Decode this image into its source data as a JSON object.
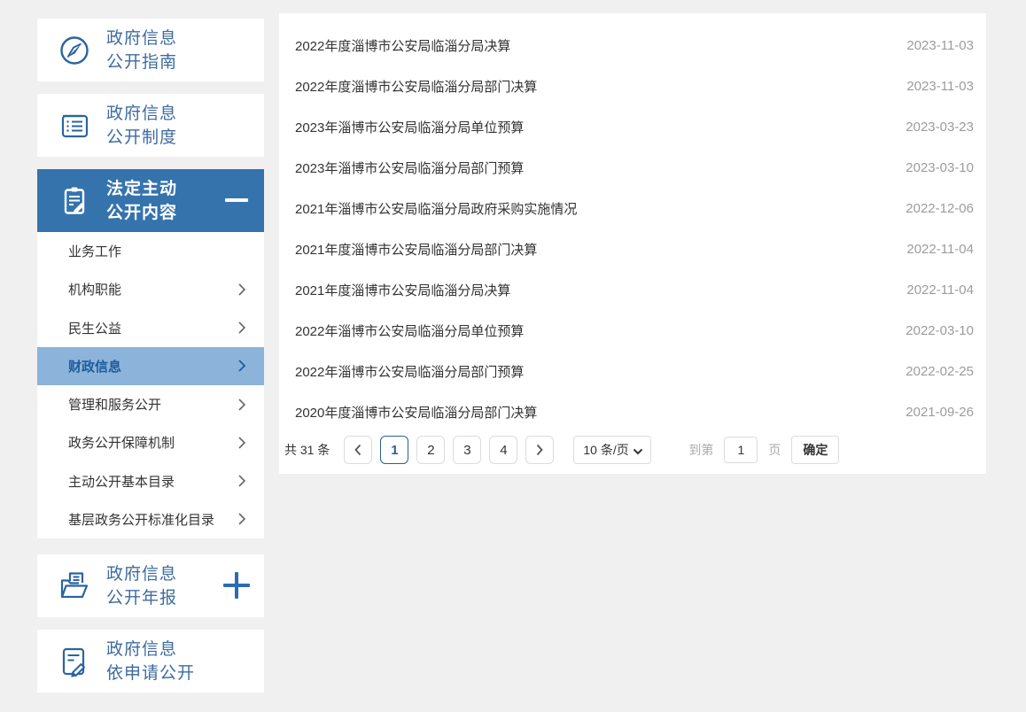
{
  "sidebar": {
    "guide": {
      "line1": "政府信息",
      "line2": "公开指南"
    },
    "system": {
      "line1": "政府信息",
      "line2": "公开制度"
    },
    "statutory": {
      "line1": "法定主动",
      "line2": "公开内容"
    },
    "annual": {
      "line1": "政府信息",
      "line2": "公开年报"
    },
    "request": {
      "line1": "政府信息",
      "line2": "依申请公开"
    },
    "menu": [
      {
        "label": "业务工作",
        "has_arrow": false,
        "selected": false
      },
      {
        "label": "机构职能",
        "has_arrow": true,
        "selected": false
      },
      {
        "label": "民生公益",
        "has_arrow": true,
        "selected": false
      },
      {
        "label": "财政信息",
        "has_arrow": true,
        "selected": true
      },
      {
        "label": "管理和服务公开",
        "has_arrow": true,
        "selected": false
      },
      {
        "label": "政务公开保障机制",
        "has_arrow": true,
        "selected": false
      },
      {
        "label": "主动公开基本目录",
        "has_arrow": true,
        "selected": false
      },
      {
        "label": "基层政务公开标准化目录",
        "has_arrow": true,
        "selected": false
      }
    ]
  },
  "list": {
    "items": [
      {
        "title": "2022年度淄博市公安局临淄分局决算",
        "date": "2023-11-03"
      },
      {
        "title": "2022年度淄博市公安局临淄分局部门决算",
        "date": "2023-11-03"
      },
      {
        "title": "2023年淄博市公安局临淄分局单位预算",
        "date": "2023-03-23"
      },
      {
        "title": "2023年淄博市公安局临淄分局部门预算",
        "date": "2023-03-10"
      },
      {
        "title": "2021年淄博市公安局临淄分局政府采购实施情况",
        "date": "2022-12-06"
      },
      {
        "title": "2021年度淄博市公安局临淄分局部门决算",
        "date": "2022-11-04"
      },
      {
        "title": "2021年度淄博市公安局临淄分局决算",
        "date": "2022-11-04"
      },
      {
        "title": "2022年淄博市公安局临淄分局单位预算",
        "date": "2022-03-10"
      },
      {
        "title": "2022年淄博市公安局临淄分局部门预算",
        "date": "2022-02-25"
      },
      {
        "title": "2020年度淄博市公安局临淄分局部门决算",
        "date": "2021-09-26"
      }
    ]
  },
  "pagination": {
    "total_text": "共 31 条",
    "pages": [
      "1",
      "2",
      "3",
      "4"
    ],
    "active_page": "1",
    "page_size": "10 条/页",
    "goto_prefix": "到第",
    "goto_value": "1",
    "goto_suffix": "页",
    "confirm_label": "确定"
  },
  "colors": {
    "page_background": "#f0f0f0",
    "header_blue": "#3573ad",
    "selected_item_bg": "#8cb3da",
    "selected_item_text": "#1d5d9b",
    "sidebar_text_blue": "#3e6b9e",
    "icon_blue": "#2b649f",
    "active_page_blue": "#2c5f96",
    "date_gray": "#9c9c9c"
  }
}
